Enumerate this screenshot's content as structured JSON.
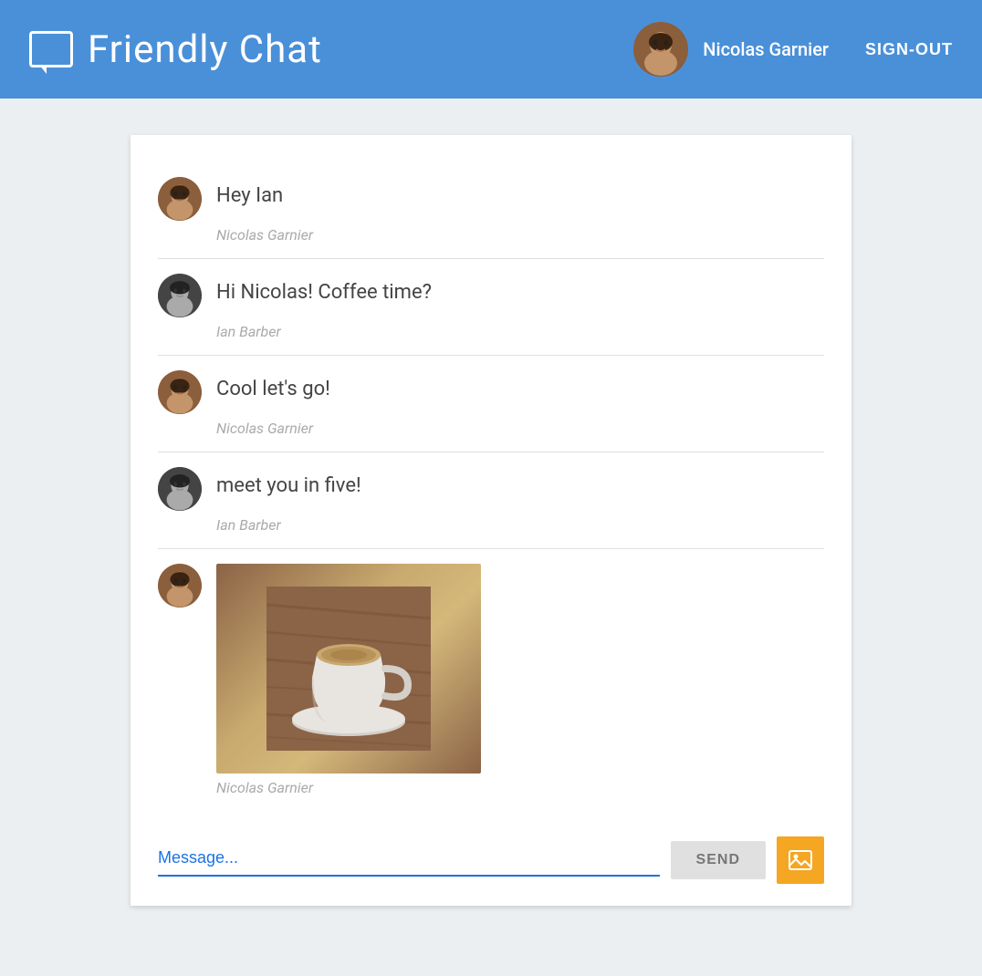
{
  "header": {
    "title": "Friendly Chat",
    "user_name": "Nicolas Garnier",
    "sign_out_label": "SIGN-OUT"
  },
  "messages": [
    {
      "id": 1,
      "text": "Hey Ian",
      "sender": "Nicolas Garnier",
      "avatar_type": "nicolas",
      "has_image": false
    },
    {
      "id": 2,
      "text": "Hi Nicolas! Coffee time?",
      "sender": "Ian Barber",
      "avatar_type": "ian",
      "has_image": false
    },
    {
      "id": 3,
      "text": "Cool let's go!",
      "sender": "Nicolas Garnier",
      "avatar_type": "nicolas",
      "has_image": false
    },
    {
      "id": 4,
      "text": "meet you in five!",
      "sender": "Ian Barber",
      "avatar_type": "ian",
      "has_image": false
    },
    {
      "id": 5,
      "text": "",
      "sender": "Nicolas Garnier",
      "avatar_type": "nicolas",
      "has_image": true
    }
  ],
  "input": {
    "placeholder": "Message...",
    "send_label": "SEND"
  }
}
